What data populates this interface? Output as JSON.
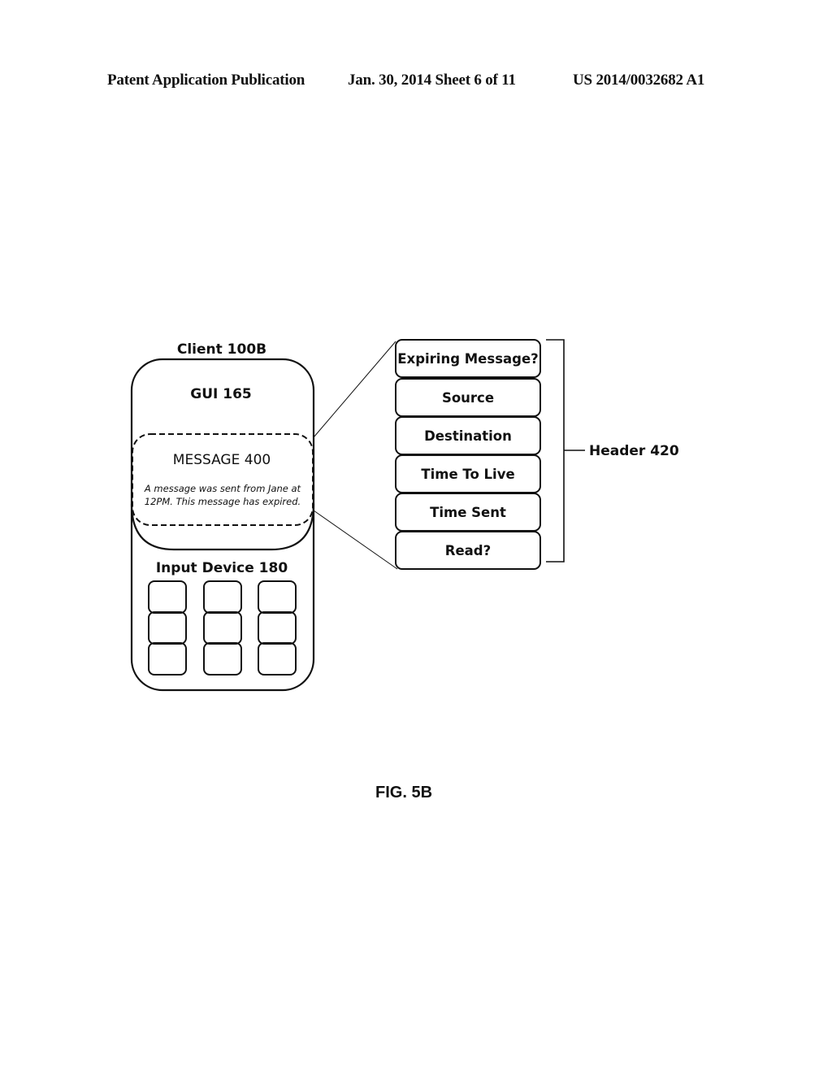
{
  "page_header": {
    "publication": "Patent Application Publication",
    "date_sheet": "Jan. 30, 2014  Sheet 6 of 11",
    "number": "US 2014/0032682 A1"
  },
  "client": {
    "title": "Client 100B",
    "gui_label": "GUI 165",
    "message": {
      "label": "MESSAGE 400",
      "body_line1": "A message was sent from Jane at",
      "body_line2": "12PM.  This message has expired."
    },
    "input_device": {
      "label": "Input Device 180",
      "keys": 9
    }
  },
  "header_fields": [
    "Expiring Message?",
    "Source",
    "Destination",
    "Time To Live",
    "Time Sent",
    "Read?"
  ],
  "header_bracket_label": "Header 420",
  "figure_caption": "FIG. 5B"
}
